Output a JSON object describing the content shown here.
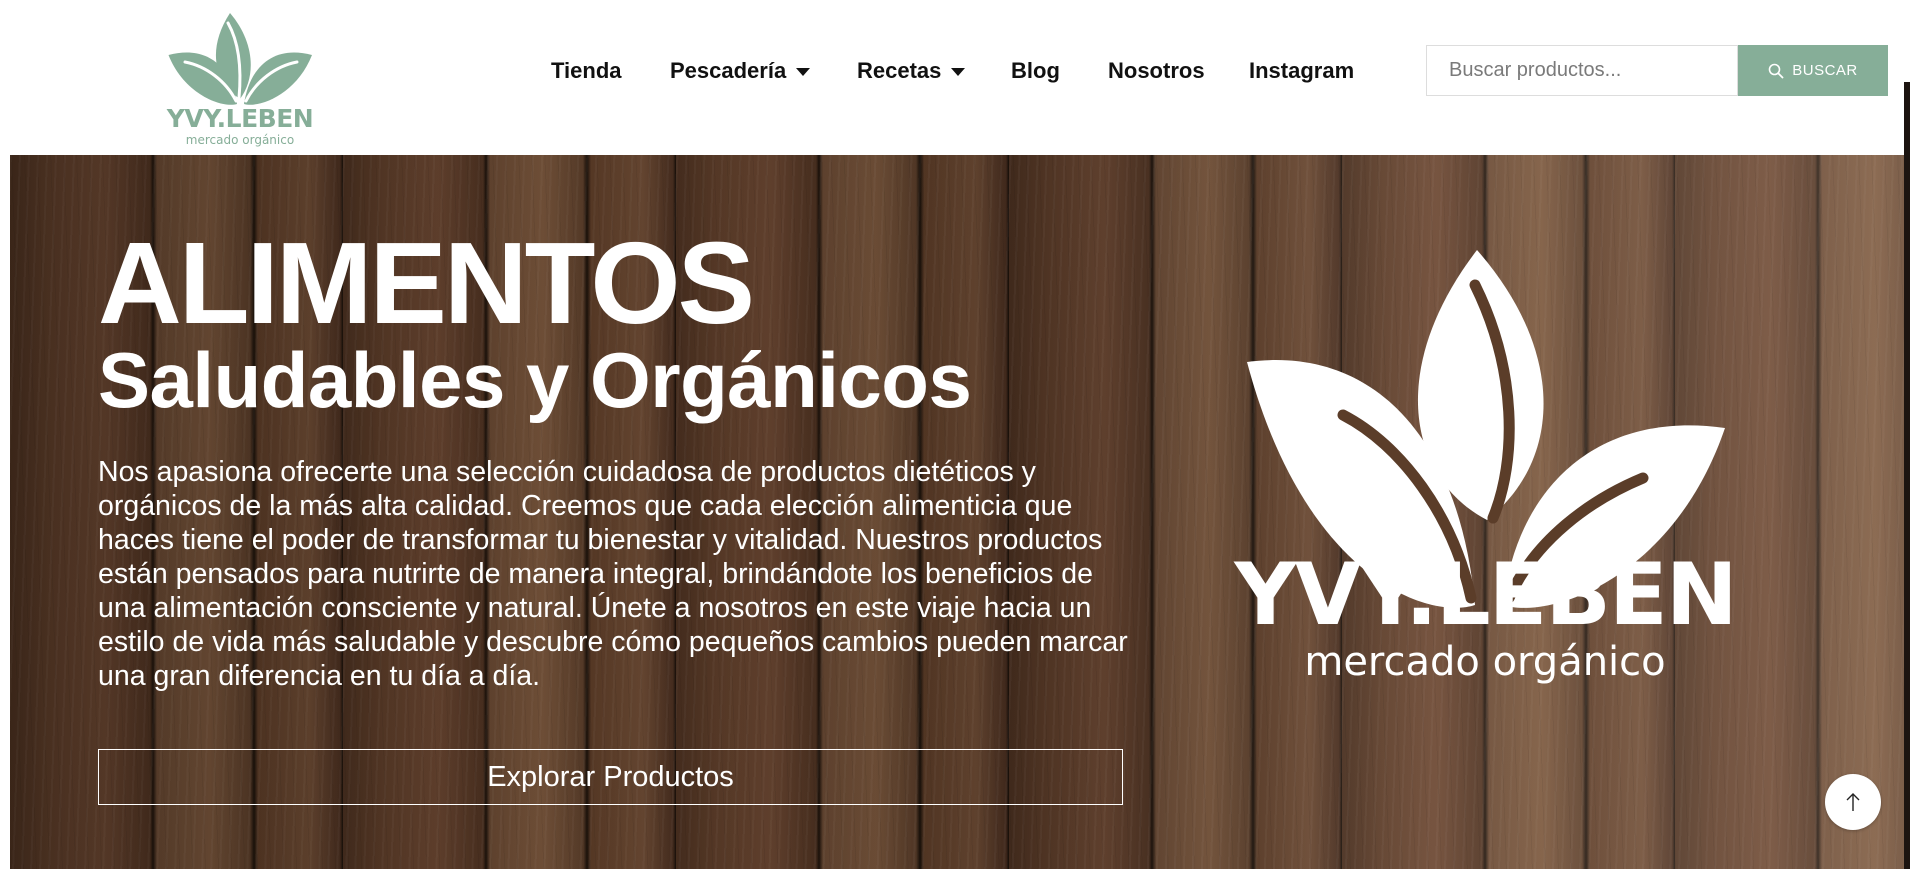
{
  "brand": {
    "name": "YVY.LEBEN",
    "tagline": "mercado orgánico",
    "color": "#86ae98"
  },
  "nav": {
    "items": [
      {
        "label": "Tienda",
        "has_dropdown": false
      },
      {
        "label": "Pescadería",
        "has_dropdown": true
      },
      {
        "label": "Recetas",
        "has_dropdown": true
      },
      {
        "label": "Blog",
        "has_dropdown": false
      },
      {
        "label": "Nosotros",
        "has_dropdown": false
      },
      {
        "label": "Instagram",
        "has_dropdown": false
      }
    ]
  },
  "search": {
    "placeholder": "Buscar productos...",
    "value": "",
    "button_label": "BUSCAR",
    "icon": "search-icon"
  },
  "hero": {
    "title": "ALIMENTOS",
    "subtitle": "Saludables y Orgánicos",
    "description": "Nos apasiona ofrecerte una selección cuidadosa de productos dietéticos y orgánicos de la más alta calidad. Creemos que cada elección alimenticia que haces tiene el poder de transformar tu bienestar y vitalidad. Nuestros productos están pensados para nutrirte de manera integral, brindándote los beneficios de una alimentación consciente y natural. Únete a nosotros en este viaje hacia un estilo de vida más saludable y descubre cómo pequeños cambios pueden marcar una gran diferencia en tu día a día.",
    "cta_label": "Explorar Productos",
    "logo_name": "YVY.LEBEN",
    "logo_tagline": "mercado orgánico"
  },
  "scroll_top": {
    "icon": "arrow-up-icon"
  }
}
